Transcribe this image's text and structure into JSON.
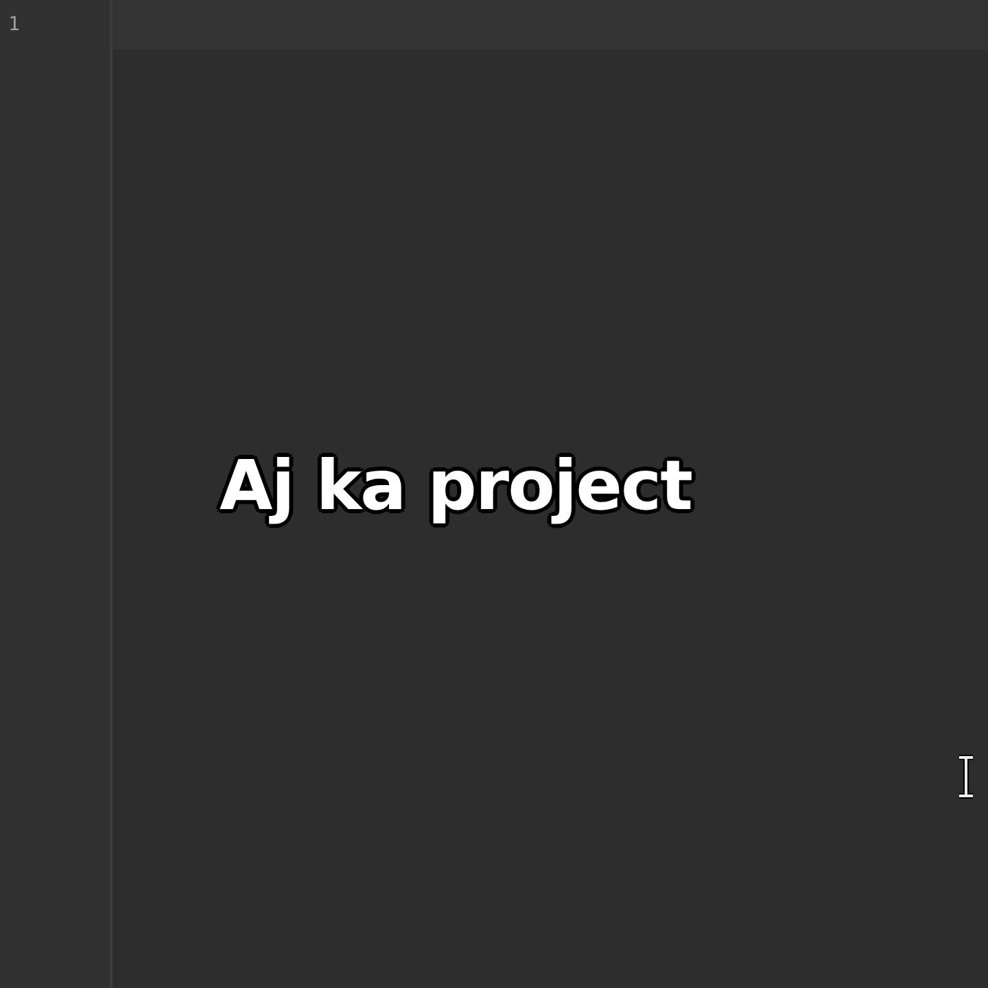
{
  "editor": {
    "line_numbers": [
      "1"
    ]
  },
  "caption": "Aj ka project"
}
